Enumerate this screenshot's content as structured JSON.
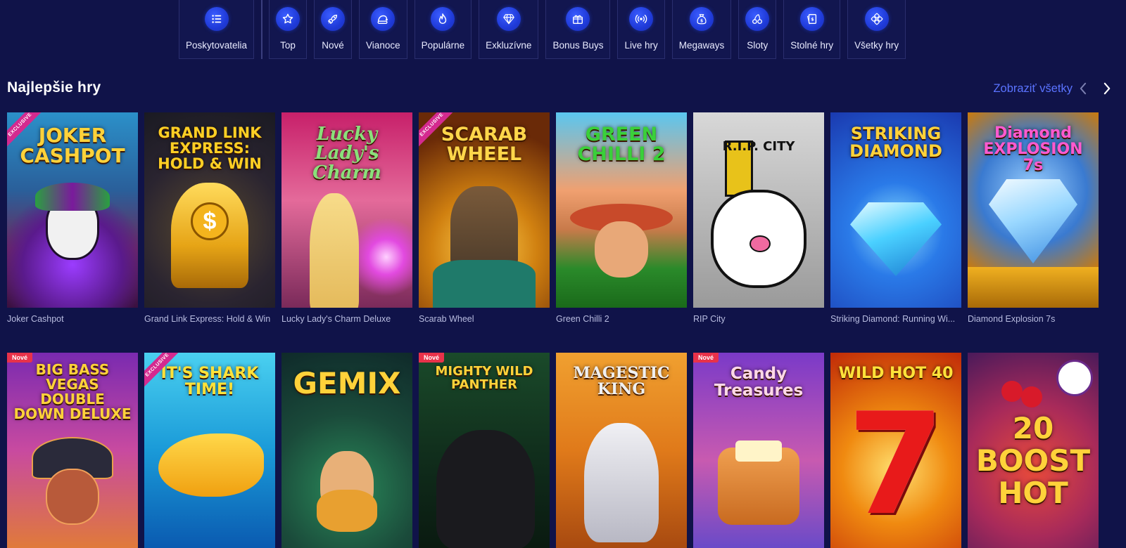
{
  "nav": {
    "categories": [
      {
        "label": "Poskytovatelia",
        "icon": "list-icon"
      },
      {
        "label": "Top",
        "icon": "star-icon"
      },
      {
        "label": "Nové",
        "icon": "rocket-icon"
      },
      {
        "label": "Vianoce",
        "icon": "santa-hat-icon"
      },
      {
        "label": "Populárne",
        "icon": "flame-icon"
      },
      {
        "label": "Exkluzívne",
        "icon": "diamond-icon"
      },
      {
        "label": "Bonus Buys",
        "icon": "gift-icon"
      },
      {
        "label": "Live hry",
        "icon": "broadcast-icon"
      },
      {
        "label": "Megaways",
        "icon": "money-bag-icon"
      },
      {
        "label": "Sloty",
        "icon": "cherries-icon"
      },
      {
        "label": "Stolné hry",
        "icon": "playing-cards-icon"
      },
      {
        "label": "Všetky hry",
        "icon": "grid-icon"
      }
    ]
  },
  "section": {
    "title": "Najlepšie hry",
    "view_all": "Zobraziť všetky"
  },
  "colors": {
    "background": "#101349",
    "accent_link": "#5a73ff",
    "icon_blue": "#2340e0",
    "new_badge": "#e8324a",
    "exclusive_ribbon": "#d42a8f"
  },
  "games_row1": [
    {
      "name": "Joker Cashpot",
      "art_title": "JOKER CASHPOT",
      "tag": "EXCLUSIVE"
    },
    {
      "name": "Grand Link Express: Hold & Win",
      "art_title": "GRAND LINK EXPRESS: HOLD & WIN",
      "tag": ""
    },
    {
      "name": "Lucky Lady's Charm Deluxe",
      "art_title": "Lucky Lady's Charm",
      "tag": ""
    },
    {
      "name": "Scarab Wheel",
      "art_title": "SCARAB WHEEL",
      "tag": "EXCLUSIVE"
    },
    {
      "name": "Green Chilli 2",
      "art_title": "GREEN CHILLI 2",
      "tag": ""
    },
    {
      "name": "RIP City",
      "art_title": "R.I.P. CITY",
      "tag": ""
    },
    {
      "name": "Striking Diamond: Running Wi...",
      "art_title": "STRIKING DIAMOND",
      "tag": ""
    },
    {
      "name": "Diamond Explosion 7s",
      "art_title": "Diamond EXPLOSION 7s",
      "tag": ""
    }
  ],
  "games_row2": [
    {
      "art_title": "BIG BASS VEGAS DOUBLE DOWN DELUXE",
      "tag": "Nové"
    },
    {
      "art_title": "IT'S SHARK TIME!",
      "tag": "EXCLUSIVE"
    },
    {
      "art_title": "GEMIX",
      "tag": ""
    },
    {
      "art_title": "MIGHTY WILD PANTHER",
      "tag": "Nové"
    },
    {
      "art_title": "MAGESTIC KING",
      "tag": ""
    },
    {
      "art_title": "Candy Treasures",
      "tag": "Nové"
    },
    {
      "art_title": "WILD HOT 40",
      "tag": ""
    },
    {
      "art_title": "20 BOOST HOT",
      "tag": ""
    }
  ]
}
